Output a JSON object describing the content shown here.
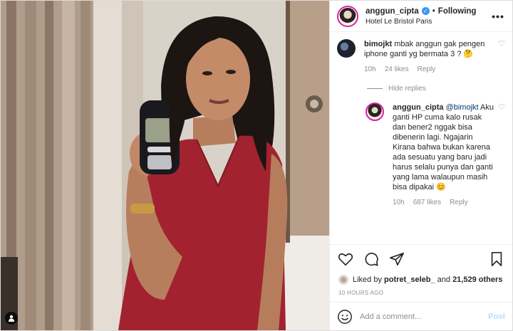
{
  "header": {
    "username": "anggun_cipta",
    "separator": "•",
    "follow_status": "Following",
    "location": "Hotel Le Bristol Paris",
    "more_icon": "ellipsis-icon",
    "more_label": "•••"
  },
  "comments": [
    {
      "username": "bimojkt",
      "text": "mbak anggun gak pengen iphone ganti yg bermata 3 ? 🤔",
      "time": "10h",
      "likes": "24 likes",
      "reply": "Reply"
    }
  ],
  "hide_replies": "Hide replies",
  "replies": [
    {
      "username": "anggun_cipta",
      "mention": "@bimojkt",
      "text": "Aku ganti HP cuma kalo rusak dan bener2 nggak bisa dibenerin lagi. Ngajarin Kirana bahwa bukan karena ada sesuatu yang baru jadi harus selalu punya dan ganti yang lama walaupun masih bisa dipakai 😊",
      "time": "10h",
      "likes": "687 likes",
      "reply": "Reply"
    }
  ],
  "actions": {
    "like_icon": "heart-icon",
    "comment_icon": "comment-icon",
    "share_icon": "share-icon",
    "save_icon": "bookmark-icon"
  },
  "likes": {
    "prefix": "Liked by",
    "user": "potret_seleb_",
    "conj": "and",
    "others": "21,529 others"
  },
  "timestamp": "10 HOURS AGO",
  "composer": {
    "placeholder": "Add a comment...",
    "post_label": "Post"
  },
  "colors": {
    "accent": "#3897f0",
    "post_disabled": "#b2dffc",
    "dress": "#a3222f"
  }
}
